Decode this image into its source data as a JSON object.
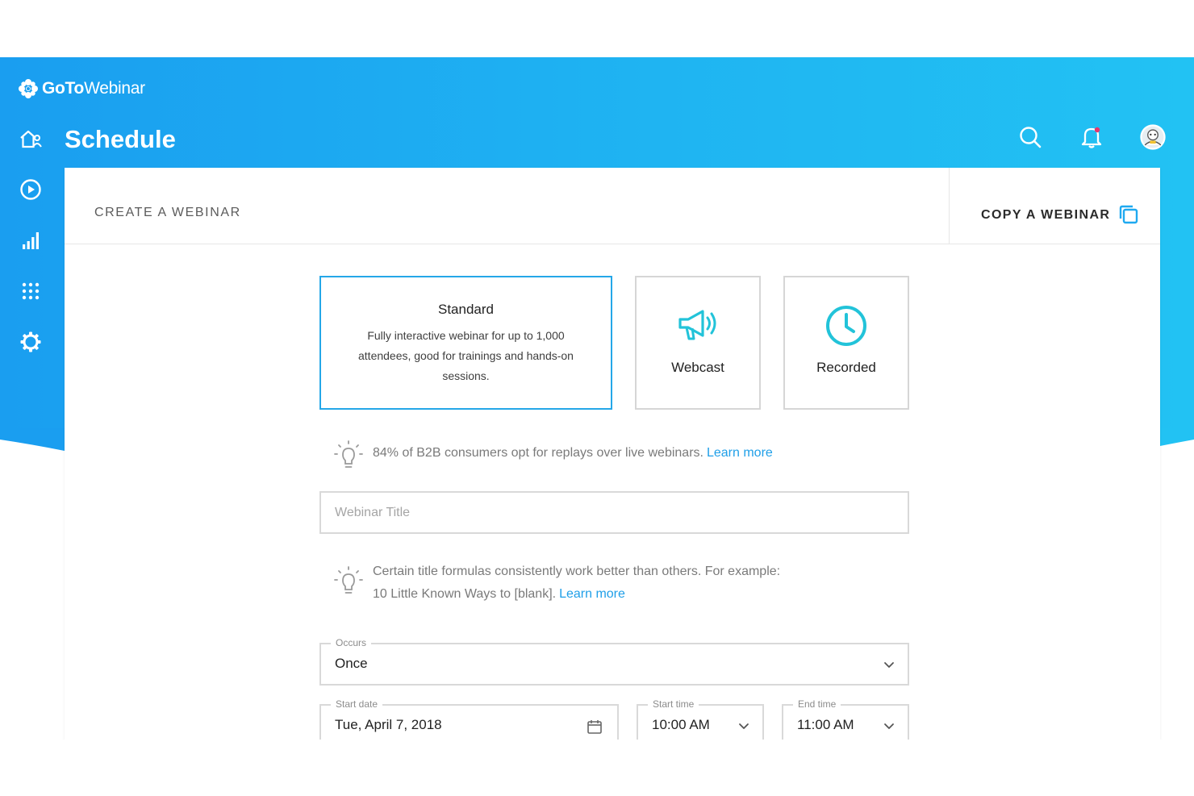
{
  "brand": {
    "name_bold": "GoTo",
    "name_light": "Webinar"
  },
  "header": {
    "title": "Schedule"
  },
  "sidebar": {
    "items": [
      {
        "name": "home",
        "icon": "home-icon"
      },
      {
        "name": "webinars",
        "icon": "play-circle-icon"
      },
      {
        "name": "analytics",
        "icon": "bar-chart-icon"
      },
      {
        "name": "apps",
        "icon": "grid-icon"
      },
      {
        "name": "settings",
        "icon": "gear-icon"
      }
    ]
  },
  "top_actions": [
    "search-icon",
    "bell-icon",
    "avatar"
  ],
  "card": {
    "create_label": "CREATE A WEBINAR",
    "copy_label": "COPY A WEBINAR"
  },
  "types": {
    "standard": {
      "title": "Standard",
      "description": "Fully interactive webinar for up to 1,000 attendees, good for trainings and hands-on sessions.",
      "selected": true
    },
    "webcast": {
      "label": "Webcast"
    },
    "recorded": {
      "label": "Recorded"
    }
  },
  "tips": {
    "replays": {
      "text": "84% of B2B consumers opt for replays over live webinars.",
      "link": "Learn more"
    },
    "title_formulas": {
      "line1": "Certain title formulas consistently work better than others. For example:",
      "line2": "10 Little Known Ways to [blank].",
      "link": "Learn more"
    }
  },
  "form": {
    "title_input": {
      "placeholder": "Webinar Title",
      "value": ""
    },
    "occurs": {
      "label": "Occurs",
      "value": "Once"
    },
    "start_date": {
      "label": "Start date",
      "value": "Tue, April 7, 2018"
    },
    "start_time": {
      "label": "Start time",
      "value": "10:00 AM"
    },
    "end_time": {
      "label": "End time",
      "value": "11:00 AM"
    }
  },
  "colors": {
    "primary_blue": "#1fa9f0",
    "accent_cyan": "#22c3d9",
    "selected_border": "#25a7e8",
    "link": "#1f9fe8"
  }
}
